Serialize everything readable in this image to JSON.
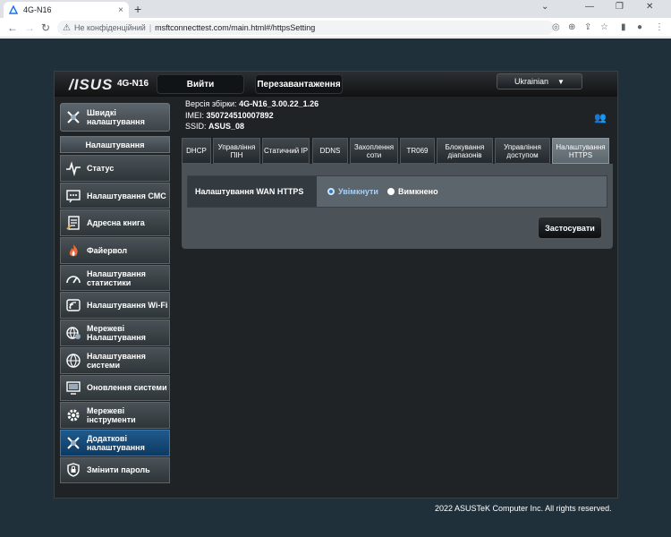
{
  "browser": {
    "tab_title": "4G-N16",
    "tab_close": "×",
    "new_tab": "+",
    "security_label": "Не конфіденційний",
    "url_sep": "|",
    "url": "msftconnecttest.com/main.html#/httpsSetting"
  },
  "router": {
    "logo": "/ISUS",
    "model": "4G-N16",
    "header_buttons": [
      "Вийти",
      "Перезавантаження"
    ],
    "language": "Ukrainian",
    "info": {
      "firmware_label": "Версія збірки:",
      "firmware_value": "4G-N16_3.00.22_1.26",
      "imei_label": "IMEI:",
      "imei_value": "350724510007892",
      "ssid_label": "SSID:",
      "ssid_value": "ASUS_08"
    },
    "quick_setup": "Швидкі налаштування",
    "sidebar_header": "Налаштування",
    "sidebar_items": [
      {
        "label": "Статус",
        "icon": "pulse-icon"
      },
      {
        "label": "Налаштування СМС",
        "icon": "sms-icon"
      },
      {
        "label": "Адресна книга",
        "icon": "address-book-icon"
      },
      {
        "label": "Файервол",
        "icon": "firewall-icon"
      },
      {
        "label": "Налаштування статистики",
        "icon": "statistics-icon"
      },
      {
        "label": "Налаштування Wi-Fi",
        "icon": "wifi-icon"
      },
      {
        "label": "Мережеві Налаштування",
        "icon": "network-icon"
      },
      {
        "label": "Налаштування системи",
        "icon": "globe-icon"
      },
      {
        "label": "Оновлення системи",
        "icon": "monitor-icon"
      },
      {
        "label": "Мережеві інструменти",
        "icon": "gear-icon"
      },
      {
        "label": "Додаткові налаштування",
        "icon": "advanced-icon",
        "active": true
      },
      {
        "label": "Змінити пароль",
        "icon": "lock-icon"
      }
    ],
    "tabs": [
      "DHCP",
      "Управління ПІН",
      "Статичний IP",
      "DDNS",
      "Захоплення соти",
      "TR069",
      "Блокування діапазонів",
      "Управління доступом",
      "Налаштування HTTPS"
    ],
    "active_tab": "Налаштування HTTPS",
    "setting": {
      "label": "Налаштування WAN HTTPS",
      "option_on": "Увімкнути",
      "option_off": "Вимкнено",
      "selected": "Увімкнути"
    },
    "apply_button": "Застосувати",
    "footer": "2022 ASUSTeK Computer Inc. All rights reserved."
  }
}
